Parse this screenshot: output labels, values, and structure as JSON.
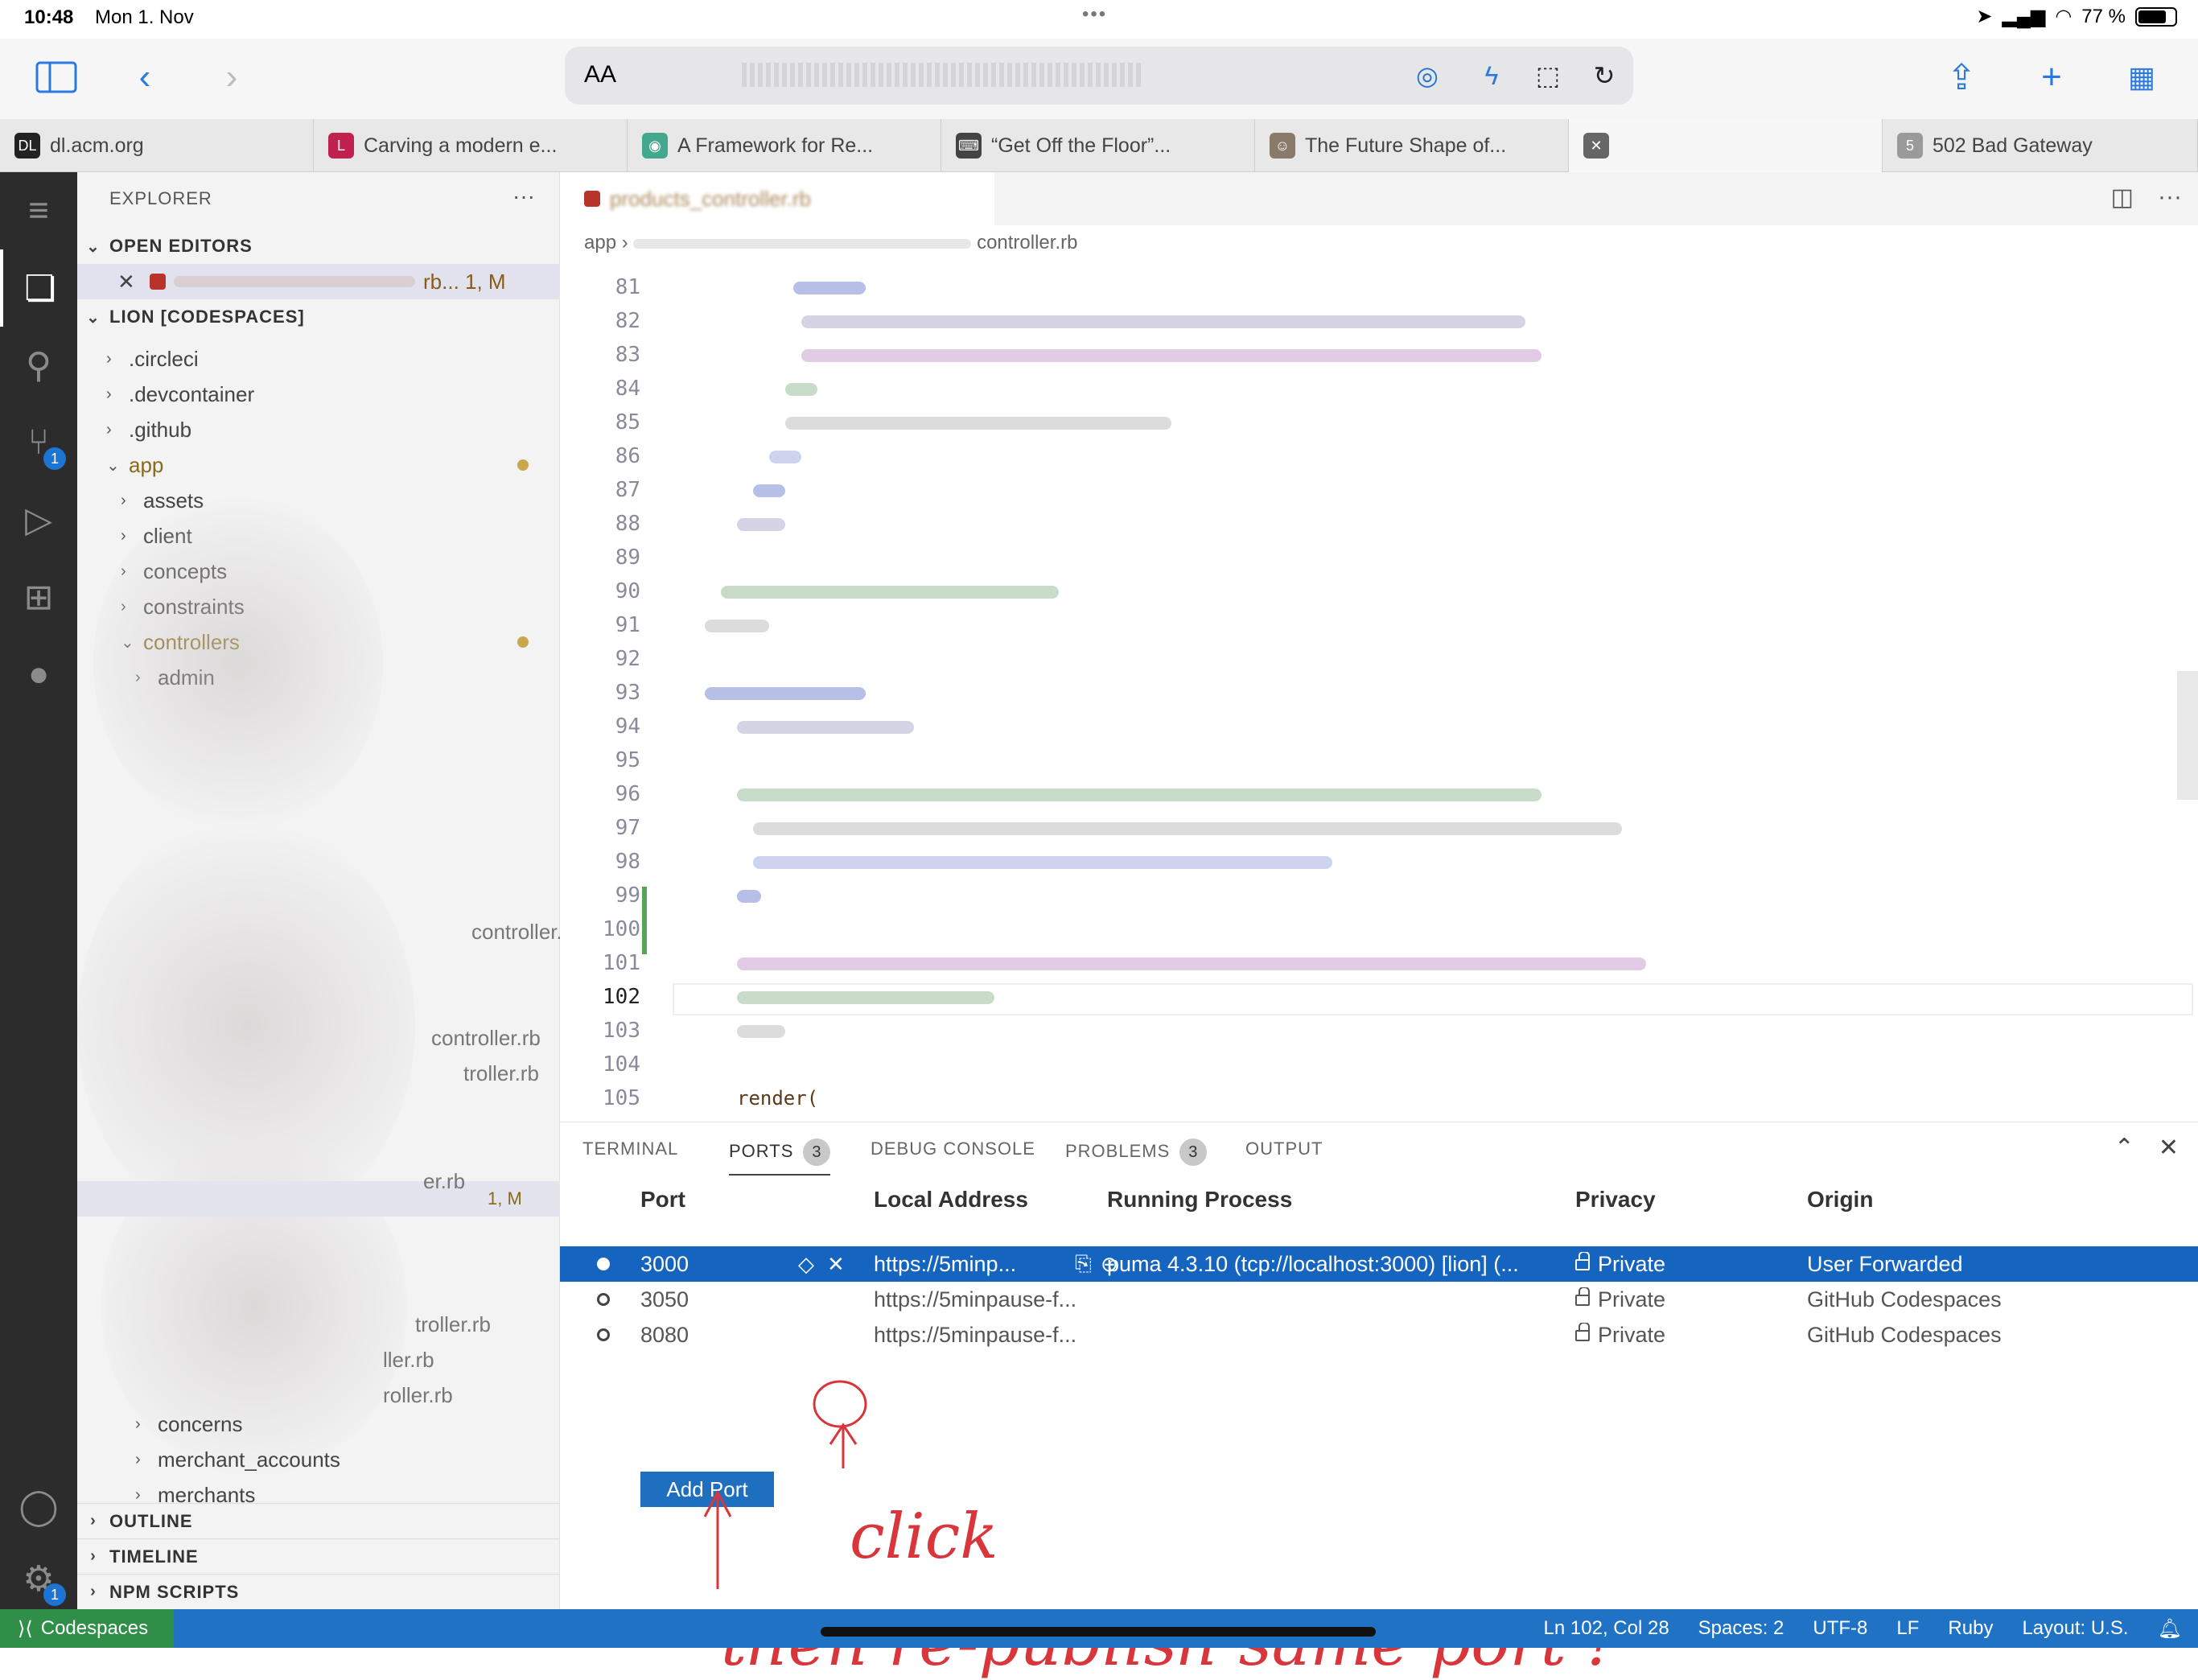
{
  "status": {
    "time": "10:48",
    "date": "Mon 1. Nov",
    "battery": "77 %",
    "battery_level": 0.77
  },
  "safari": {
    "text_size_label": "AA"
  },
  "tabs": [
    {
      "title": "dl.acm.org",
      "fav_color": "#222222",
      "fav_glyph": "DL"
    },
    {
      "title": "Carving a modern e...",
      "fav_color": "#c0224d",
      "fav_glyph": "L"
    },
    {
      "title": "A Framework for Re...",
      "fav_color": "#44a88f",
      "fav_glyph": "◉"
    },
    {
      "title": "“Get Off the Floor”...",
      "fav_color": "#444444",
      "fav_glyph": "⌨"
    },
    {
      "title": "The Future Shape of...",
      "fav_color": "#8a7a6a",
      "fav_glyph": "☺"
    },
    {
      "title": "",
      "fav_color": "#666666",
      "fav_glyph": "✕"
    },
    {
      "title": "502 Bad Gateway",
      "fav_color": "#9a9a9a",
      "fav_glyph": "5"
    }
  ],
  "explorer": {
    "title": "EXPLORER",
    "open_editors_label": "OPEN EDITORS",
    "open_editor_suffix": "rb... 1, M",
    "workspace_label": "LION [CODESPACES]",
    "items": [
      {
        "label": ".circleci",
        "indent": 0,
        "open": false
      },
      {
        "label": ".devcontainer",
        "indent": 0,
        "open": false
      },
      {
        "label": ".github",
        "indent": 0,
        "open": false
      },
      {
        "label": "app",
        "indent": 0,
        "open": true,
        "modified": true
      },
      {
        "label": "assets",
        "indent": 1,
        "open": false
      },
      {
        "label": "client",
        "indent": 1,
        "open": false
      },
      {
        "label": "concepts",
        "indent": 1,
        "open": false
      },
      {
        "label": "constraints",
        "indent": 1,
        "open": false
      },
      {
        "label": "controllers",
        "indent": 1,
        "open": true,
        "modified": true
      },
      {
        "label": "admin",
        "indent": 2,
        "open": false
      }
    ],
    "partial_files": [
      "controller....",
      "controller.rb",
      "troller.rb",
      "er.rb",
      "troller.rb",
      "ller.rb",
      "roller.rb"
    ],
    "selected_file_suffix": "1, M",
    "bottom_items": [
      {
        "label": "concerns",
        "indent": 1
      },
      {
        "label": "merchant_accounts",
        "indent": 1
      },
      {
        "label": "merchants",
        "indent": 1
      }
    ],
    "sections": [
      "OUTLINE",
      "TIMELINE",
      "NPM SCRIPTS"
    ]
  },
  "editor": {
    "tab_label": "products_controller.rb",
    "breadcrumb_start": "app",
    "breadcrumb_end": "controller.rb",
    "line_numbers": [
      "81",
      "82",
      "83",
      "84",
      "85",
      "86",
      "87",
      "88",
      "89",
      "90",
      "91",
      "92",
      "93",
      "94",
      "95",
      "96",
      "97",
      "98",
      "99",
      "100",
      "101",
      "102",
      "103",
      "104",
      "105"
    ],
    "current_line": "102",
    "last_line_text": "render("
  },
  "panel": {
    "tabs": [
      {
        "label": "TERMINAL",
        "count": ""
      },
      {
        "label": "PORTS",
        "count": "3",
        "active": true
      },
      {
        "label": "DEBUG CONSOLE",
        "count": ""
      },
      {
        "label": "PROBLEMS",
        "count": "3"
      },
      {
        "label": "OUTPUT",
        "count": ""
      }
    ],
    "columns": [
      "Port",
      "Local Address",
      "Running Process",
      "Privacy",
      "Origin"
    ],
    "rows": [
      {
        "port": "3000",
        "address": "https://5minp...",
        "process": "puma 4.3.10 (tcp://localhost:3000) [lion] (...",
        "privacy": "Private",
        "origin": "User Forwarded",
        "selected": true
      },
      {
        "port": "3050",
        "address": "https://5minpause-f...",
        "process": "",
        "privacy": "Private",
        "origin": "GitHub Codespaces",
        "selected": false
      },
      {
        "port": "8080",
        "address": "https://5minpause-f...",
        "process": "",
        "privacy": "Private",
        "origin": "GitHub Codespaces",
        "selected": false
      }
    ],
    "add_port_label": "Add Port"
  },
  "annotations": {
    "click": "click",
    "note": "then re-publish same port !"
  },
  "statusbar": {
    "remote_label": "Codespaces",
    "position": "Ln 102, Col 28",
    "spaces": "Spaces: 2",
    "encoding": "UTF-8",
    "eol": "LF",
    "language": "Ruby",
    "layout": "Layout: U.S."
  },
  "colors": {
    "accent": "#1e6fbf",
    "selection": "#1565c0",
    "annotation": "#d8363a",
    "remote": "#2f8f49"
  }
}
